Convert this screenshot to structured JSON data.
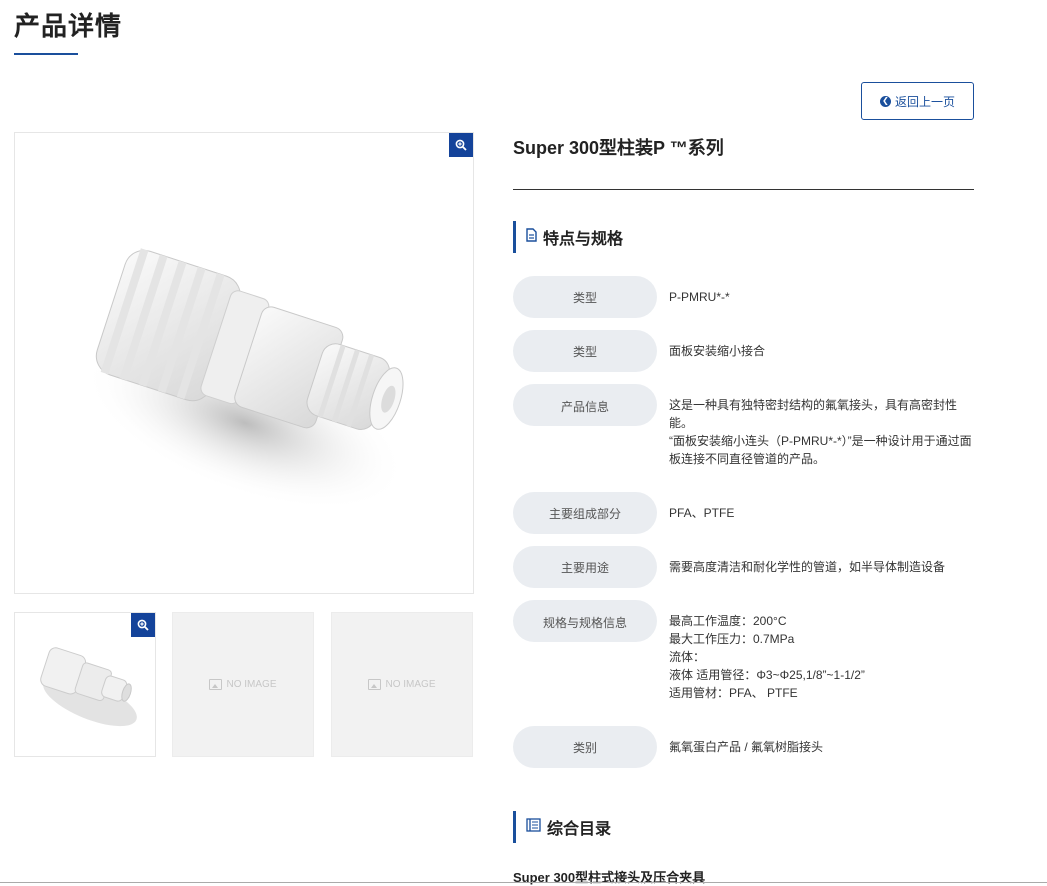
{
  "page": {
    "title": "产品详情",
    "back_label": "返回上一页"
  },
  "product": {
    "name": "Super 300型柱装P ™系列",
    "thumbnails": [
      {
        "type": "image"
      },
      {
        "type": "placeholder",
        "label": "NO IMAGE"
      },
      {
        "type": "placeholder",
        "label": "NO IMAGE"
      }
    ]
  },
  "features": {
    "heading": "特点与规格",
    "rows": [
      {
        "label": "类型",
        "value": "P-PMRU*-*"
      },
      {
        "label": "类型",
        "value": "面板安装缩小接合"
      },
      {
        "label": "产品信息",
        "value": "这是一种具有独特密封结构的氟氧接头，具有高密封性能。\n“面板安装缩小连头（P-PMRU*-*）”是一种设计用于通过面板连接不同直径管道的产品。"
      },
      {
        "label": "主要组成部分",
        "value": "PFA、PTFE"
      },
      {
        "label": "主要用途",
        "value": "需要高度清洁和耐化学性的管道，如半导体制造设备"
      },
      {
        "label": "规格与规格信息",
        "value": "最高工作温度：200°C\n最大工作压力：0.7MPa\n流体：\n液体 适用管径：Φ3~Φ25,1/8”~1-1/2”\n适用管材：PFA、 PTFE"
      },
      {
        "label": "类别",
        "value": "氟氧蛋白产品 / 氟氧树脂接头"
      }
    ]
  },
  "catalog": {
    "heading": "综合目录",
    "items": [
      "Super 300型柱式接头及压合夹具"
    ]
  },
  "colors": {
    "accent": "#1a4f9c",
    "label_bg": "#eaedf1"
  }
}
